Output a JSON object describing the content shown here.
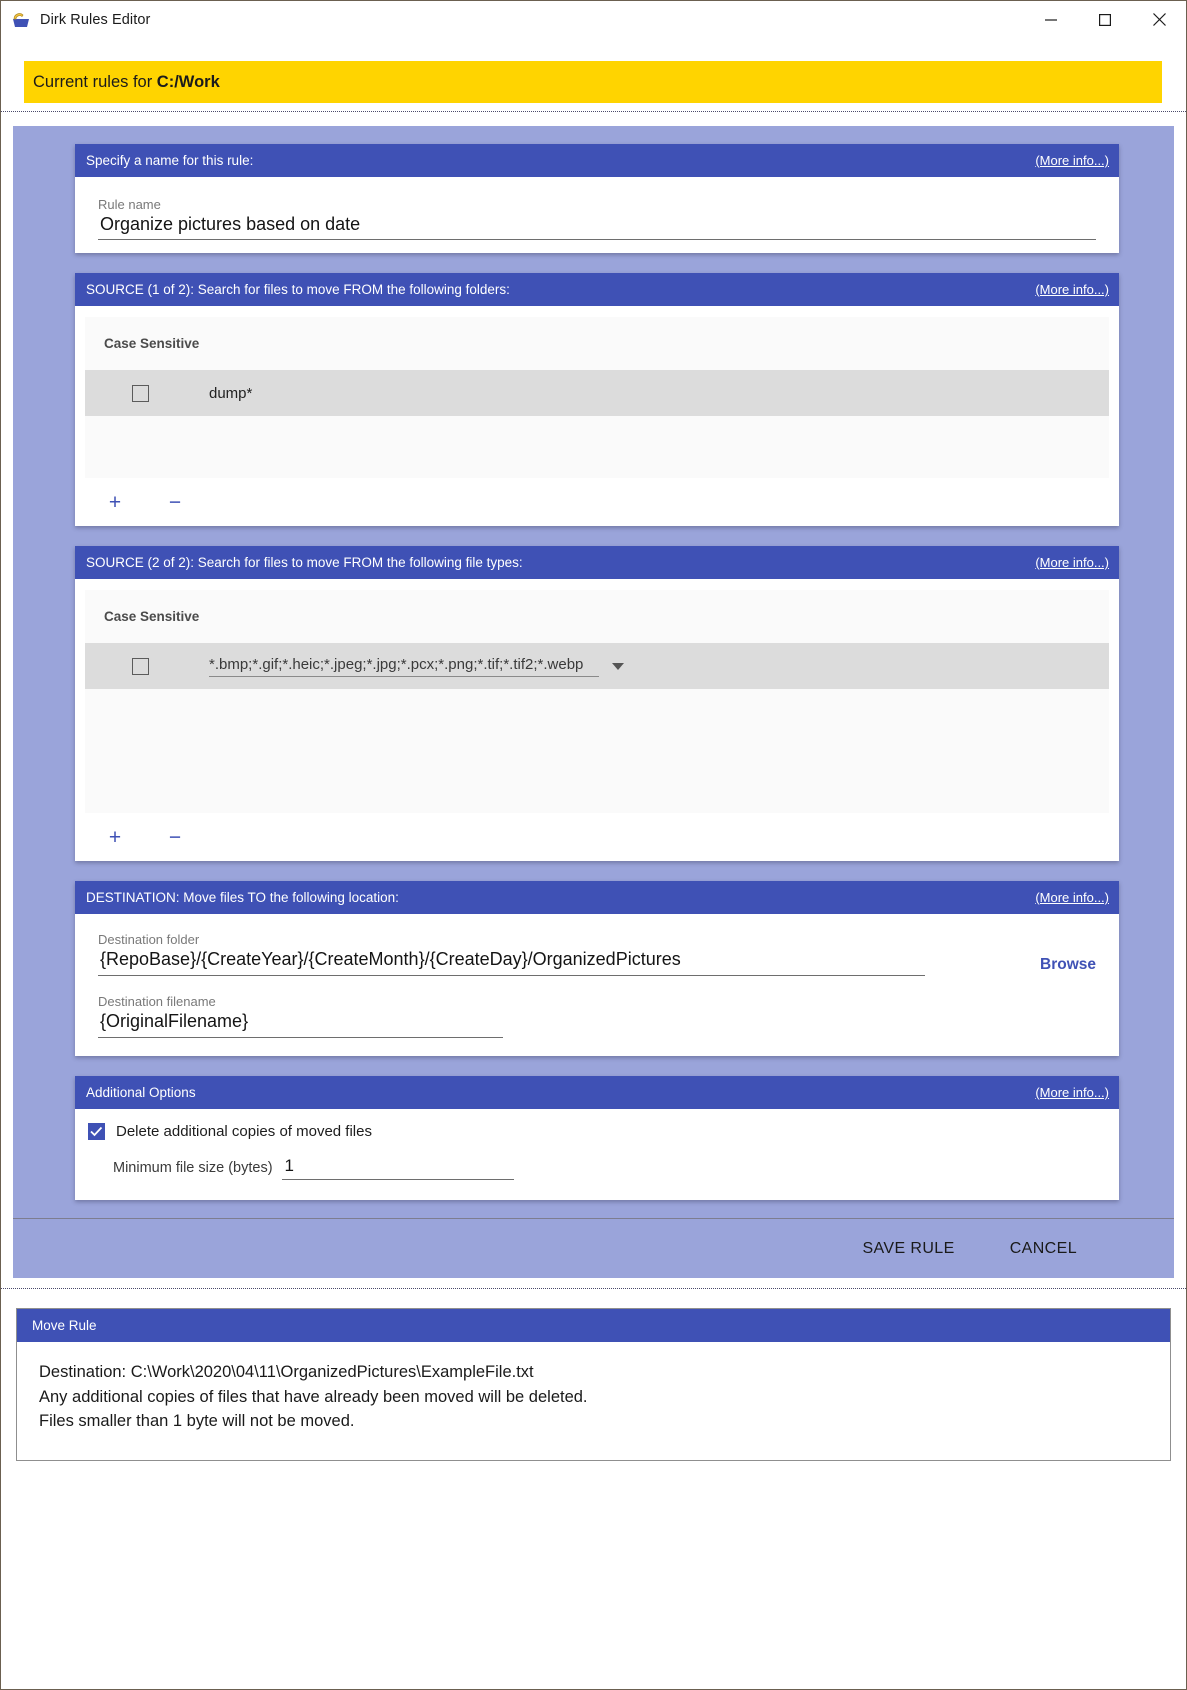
{
  "window": {
    "title": "Dirk Rules Editor",
    "icon": "app-icon",
    "minimize_label": "Minimize",
    "maximize_label": "Maximize",
    "close_label": "Close"
  },
  "banner": {
    "prefix": "Current rules for ",
    "path": "C:/Work"
  },
  "more_info_label": "(More info...)",
  "sections": {
    "rule_name": {
      "header": "Specify a name for this rule:",
      "field_label": "Rule name",
      "field_value": "Organize pictures based on date"
    },
    "source1": {
      "header": "SOURCE (1 of 2): Search for files to move FROM the following folders:",
      "column_header": "Case Sensitive",
      "rows": [
        {
          "checked": false,
          "value": "dump*"
        }
      ],
      "add_label": "+",
      "remove_label": "−"
    },
    "source2": {
      "header": "SOURCE (2 of 2): Search for files to move FROM the following file types:",
      "column_header": "Case Sensitive",
      "rows": [
        {
          "checked": false,
          "value": "*.bmp;*.gif;*.heic;*.jpeg;*.jpg;*.pcx;*.png;*.tif;*.tif2;*.webp"
        }
      ],
      "add_label": "+",
      "remove_label": "−"
    },
    "destination": {
      "header": "DESTINATION: Move files TO the following location:",
      "folder_label": "Destination folder",
      "folder_value": "{RepoBase}/{CreateYear}/{CreateMonth}/{CreateDay}/OrganizedPictures",
      "filename_label": "Destination filename",
      "filename_value": "{OriginalFilename}",
      "browse_label": "Browse"
    },
    "additional_options": {
      "header": "Additional Options",
      "delete_copies_label": "Delete additional copies of moved files",
      "delete_copies_checked": true,
      "min_size_label": "Minimum file size (bytes)",
      "min_size_value": "1"
    }
  },
  "actions": {
    "save_label": "SAVE RULE",
    "cancel_label": "CANCEL"
  },
  "summary": {
    "header": "Move Rule",
    "lines": [
      "Destination: C:\\Work\\2020\\04\\11\\OrganizedPictures\\ExampleFile.txt",
      "Any additional copies of files that have already been moved will be deleted.",
      "Files smaller than 1 byte will not be moved."
    ]
  },
  "colors": {
    "accent": "#3f51b5",
    "banner": "#ffd400",
    "panel": "#9aa4da"
  }
}
